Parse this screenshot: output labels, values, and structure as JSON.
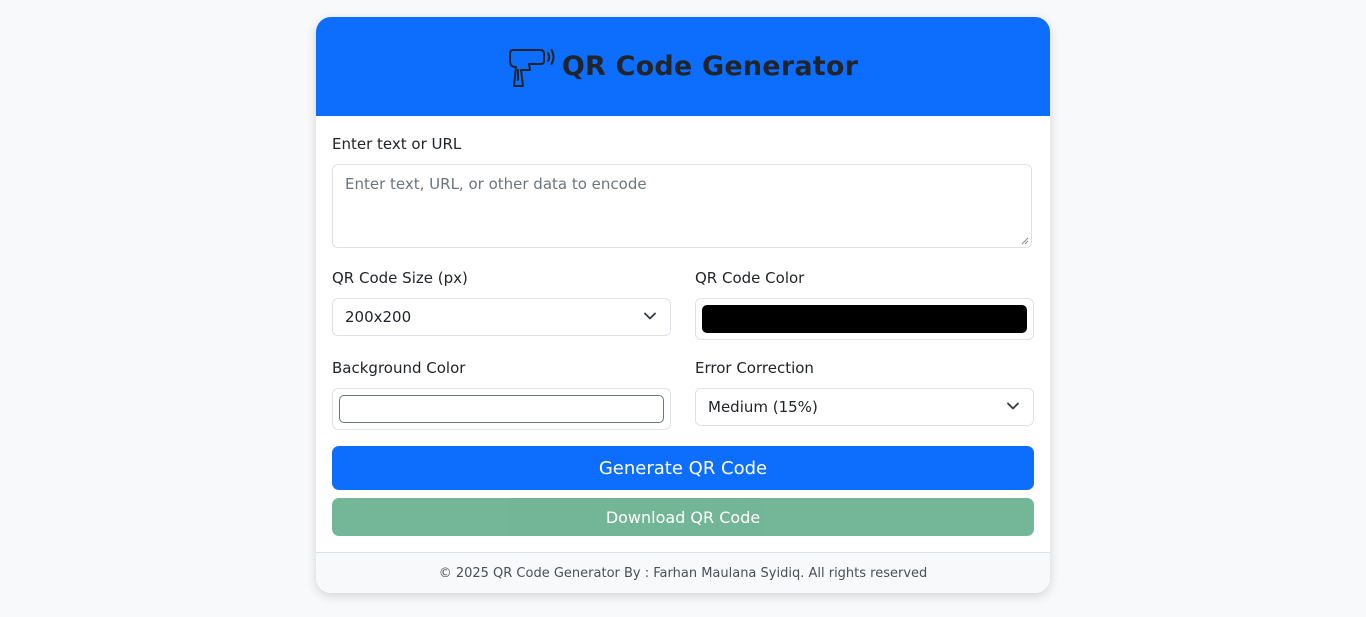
{
  "header": {
    "title": "QR Code Generator",
    "icon": "qr-scanner-icon",
    "background": "#0d6efd"
  },
  "form": {
    "text_label": "Enter text or URL",
    "text_placeholder": "Enter text, URL, or other data to encode",
    "text_value": "",
    "size_label": "QR Code Size (px)",
    "size_value": "200x200",
    "color_label": "QR Code Color",
    "color_value": "#000000",
    "bg_label": "Background Color",
    "bg_value": "#ffffff",
    "ec_label": "Error Correction",
    "ec_value": "Medium (15%)"
  },
  "buttons": {
    "generate_label": "Generate QR Code",
    "generate_color": "#0d6efd",
    "download_label": "Download QR Code",
    "download_color": "#6cb392",
    "download_disabled": true
  },
  "footer": {
    "text": "© 2025 QR Code Generator By : Farhan Maulana Syidiq. All rights reserved"
  }
}
